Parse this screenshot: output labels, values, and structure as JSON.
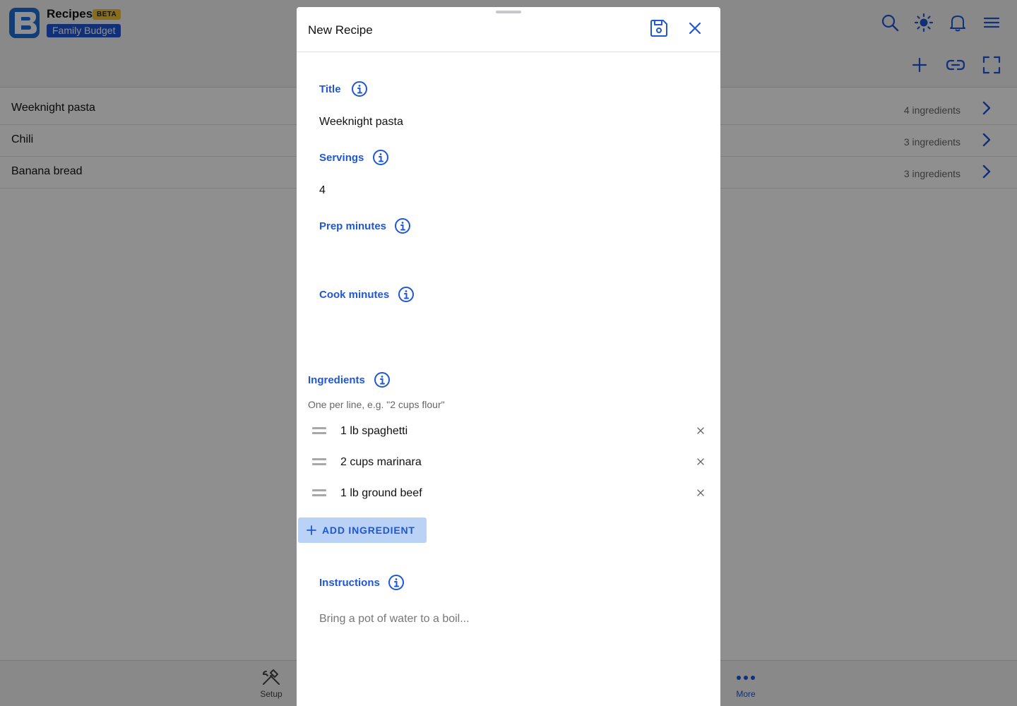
{
  "app": {
    "title": "Recipes",
    "beta_badge": "BETA",
    "workspace": "Family Budget",
    "brand_color": "#1f57d6"
  },
  "top_icons": [
    "search-icon",
    "brightness-icon",
    "bell-icon",
    "menu-icon"
  ],
  "toolbar_icons": [
    "plus-icon",
    "link-icon",
    "fullscreen-icon"
  ],
  "recipes": [
    {
      "name": "Weeknight pasta",
      "count": "4 ingredients"
    },
    {
      "name": "Chili",
      "count": "3 ingredients"
    },
    {
      "name": "Banana bread",
      "count": "3 ingredients"
    }
  ],
  "bottom_tabs": {
    "setup": "Setup",
    "more": "More"
  },
  "modal": {
    "title": "New Recipe",
    "fields": {
      "title_label": "Title",
      "title_value": "Weeknight pasta",
      "servings_label": "Servings",
      "servings_value": "4",
      "prep_label": "Prep minutes",
      "prep_value": "",
      "cook_label": "Cook minutes",
      "cook_value": ""
    },
    "ingredients": {
      "label": "Ingredients",
      "hint": "One per line, e.g. \"2 cups flour\"",
      "items": [
        "1 lb spaghetti",
        "2 cups marinara",
        "1 lb ground beef"
      ],
      "add_label": "ADD INGREDIENT"
    },
    "instructions": {
      "label": "Instructions",
      "placeholder": "Bring a pot of water to a boil..."
    }
  }
}
